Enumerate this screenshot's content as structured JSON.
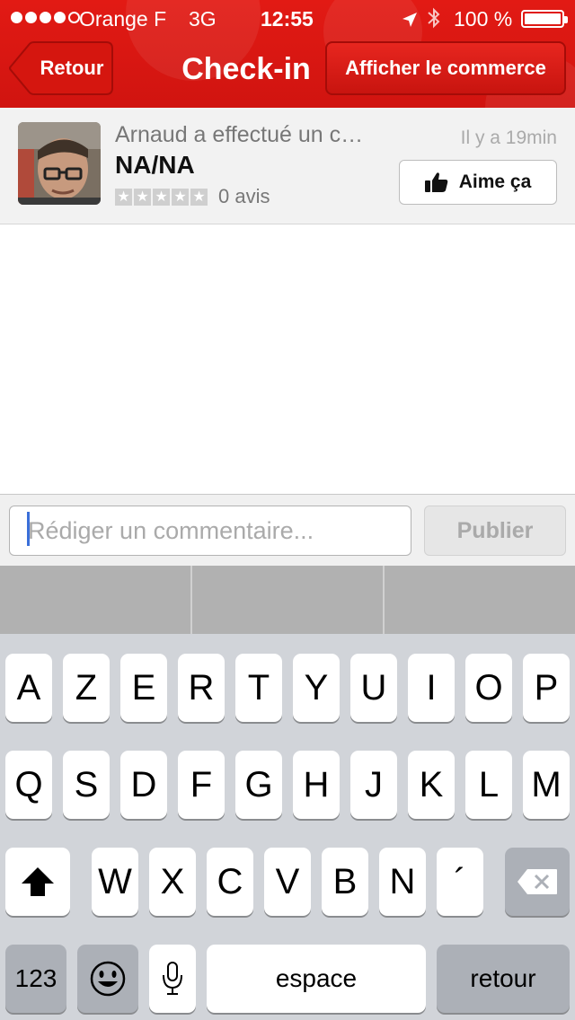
{
  "status_bar": {
    "carrier": "Orange F",
    "network": "3G",
    "time": "12:55",
    "battery": "100 %"
  },
  "nav": {
    "back_label": "Retour",
    "title": "Check-in",
    "shop_label": "Afficher le commerce"
  },
  "checkin": {
    "text": "Arnaud a effectué un c…",
    "venue": "NA/NA",
    "rating": 0,
    "reviews": "0 avis",
    "time_ago": "Il y a 19min",
    "like_label": "Aime ça"
  },
  "comment": {
    "placeholder": "Rédiger un commentaire...",
    "publish_label": "Publier"
  },
  "keyboard": {
    "row1": [
      "A",
      "Z",
      "E",
      "R",
      "T",
      "Y",
      "U",
      "I",
      "O",
      "P"
    ],
    "row2": [
      "Q",
      "S",
      "D",
      "F",
      "G",
      "H",
      "J",
      "K",
      "L",
      "M"
    ],
    "row3": [
      "W",
      "X",
      "C",
      "V",
      "B",
      "N",
      "´"
    ],
    "numbers": "123",
    "space": "espace",
    "return": "retour"
  },
  "colors": {
    "brand_red": "#d8150f",
    "keyboard_bg": "#d1d4d9"
  }
}
